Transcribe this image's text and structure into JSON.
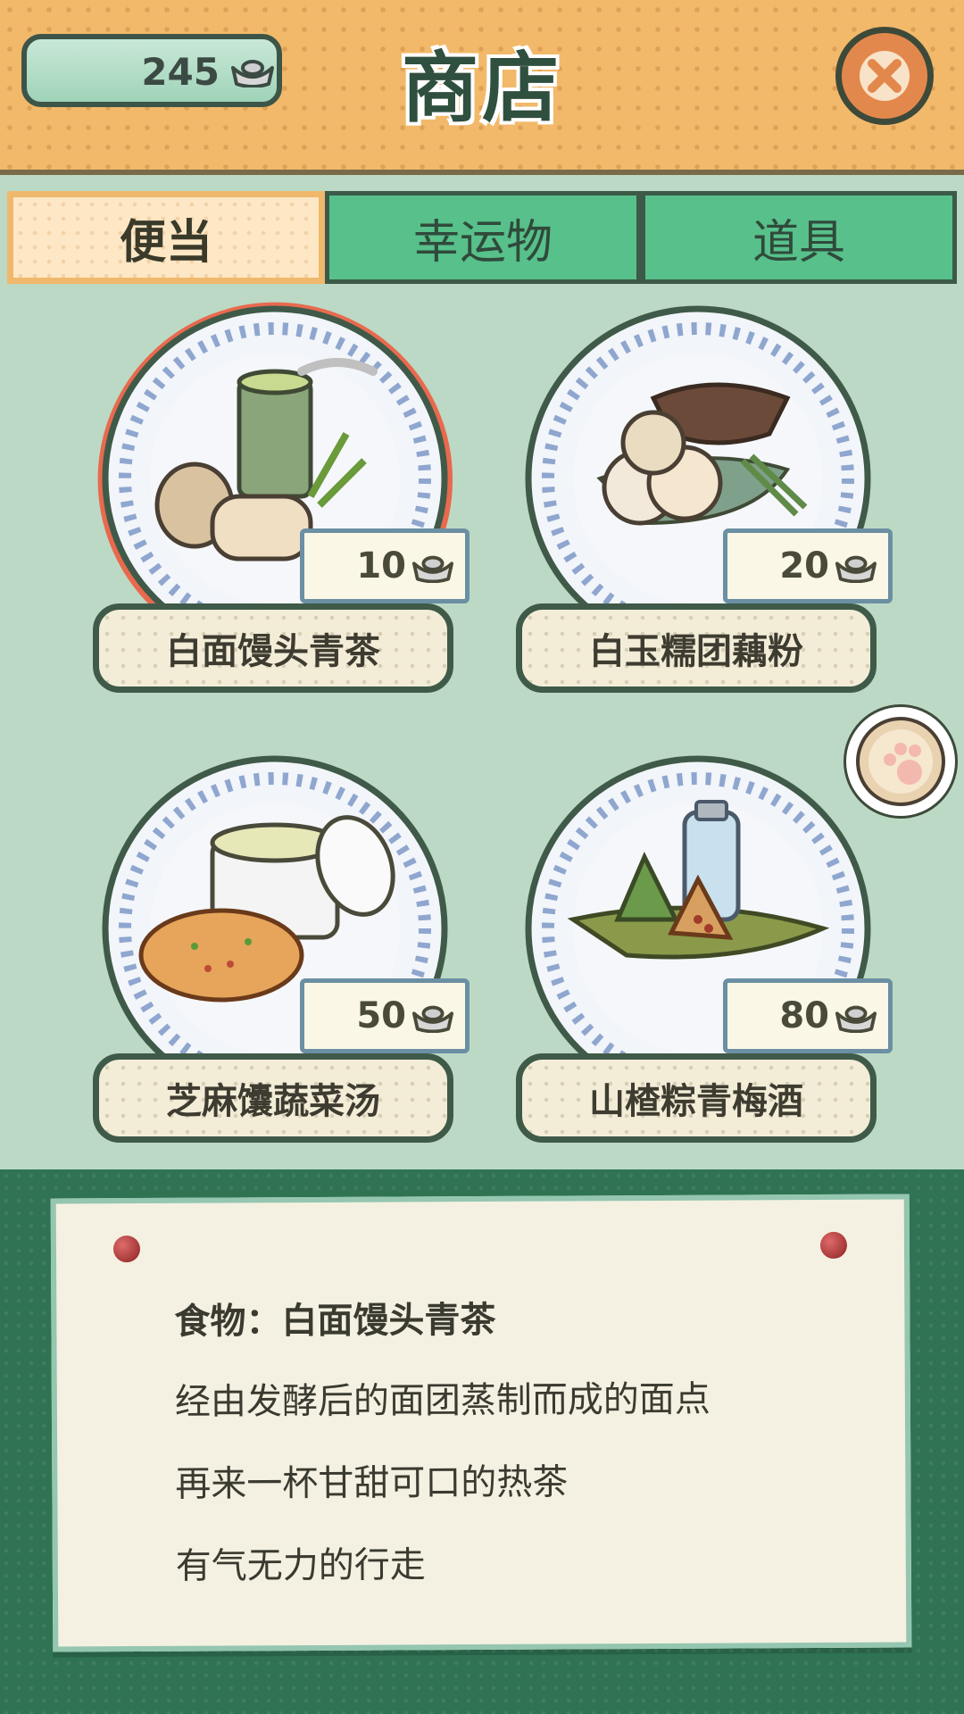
{
  "header": {
    "currency_value": "245",
    "title": "商店"
  },
  "tabs": [
    {
      "label": "便当",
      "active": true
    },
    {
      "label": "幸运物",
      "active": false
    },
    {
      "label": "道具",
      "active": false
    }
  ],
  "items": [
    {
      "name": "白面馒头青茶",
      "price": "10",
      "selected": true
    },
    {
      "name": "白玉糯团藕粉",
      "price": "20",
      "selected": false
    },
    {
      "name": "芝麻馕蔬菜汤",
      "price": "50",
      "selected": false
    },
    {
      "name": "山楂粽青梅酒",
      "price": "80",
      "selected": false
    }
  ],
  "description": {
    "title": "食物：白面馒头青茶",
    "lines": [
      "经由发酵后的面团蒸制而成的面点",
      "再来一杯甘甜可口的热茶",
      "有气无力的行走"
    ]
  },
  "icons": {
    "currency": "silver-ingot-icon",
    "close": "close-icon",
    "paw": "paw-icon"
  },
  "colors": {
    "header_bg": "#f2b96a",
    "tab_active_bg": "#fde7c5",
    "tab_inactive_bg": "#58c08a",
    "panel_bg": "#bcd9c5",
    "bottom_bg": "#2f7352",
    "close_button": "#e3884c",
    "selected_ring": "#e86a4e"
  }
}
